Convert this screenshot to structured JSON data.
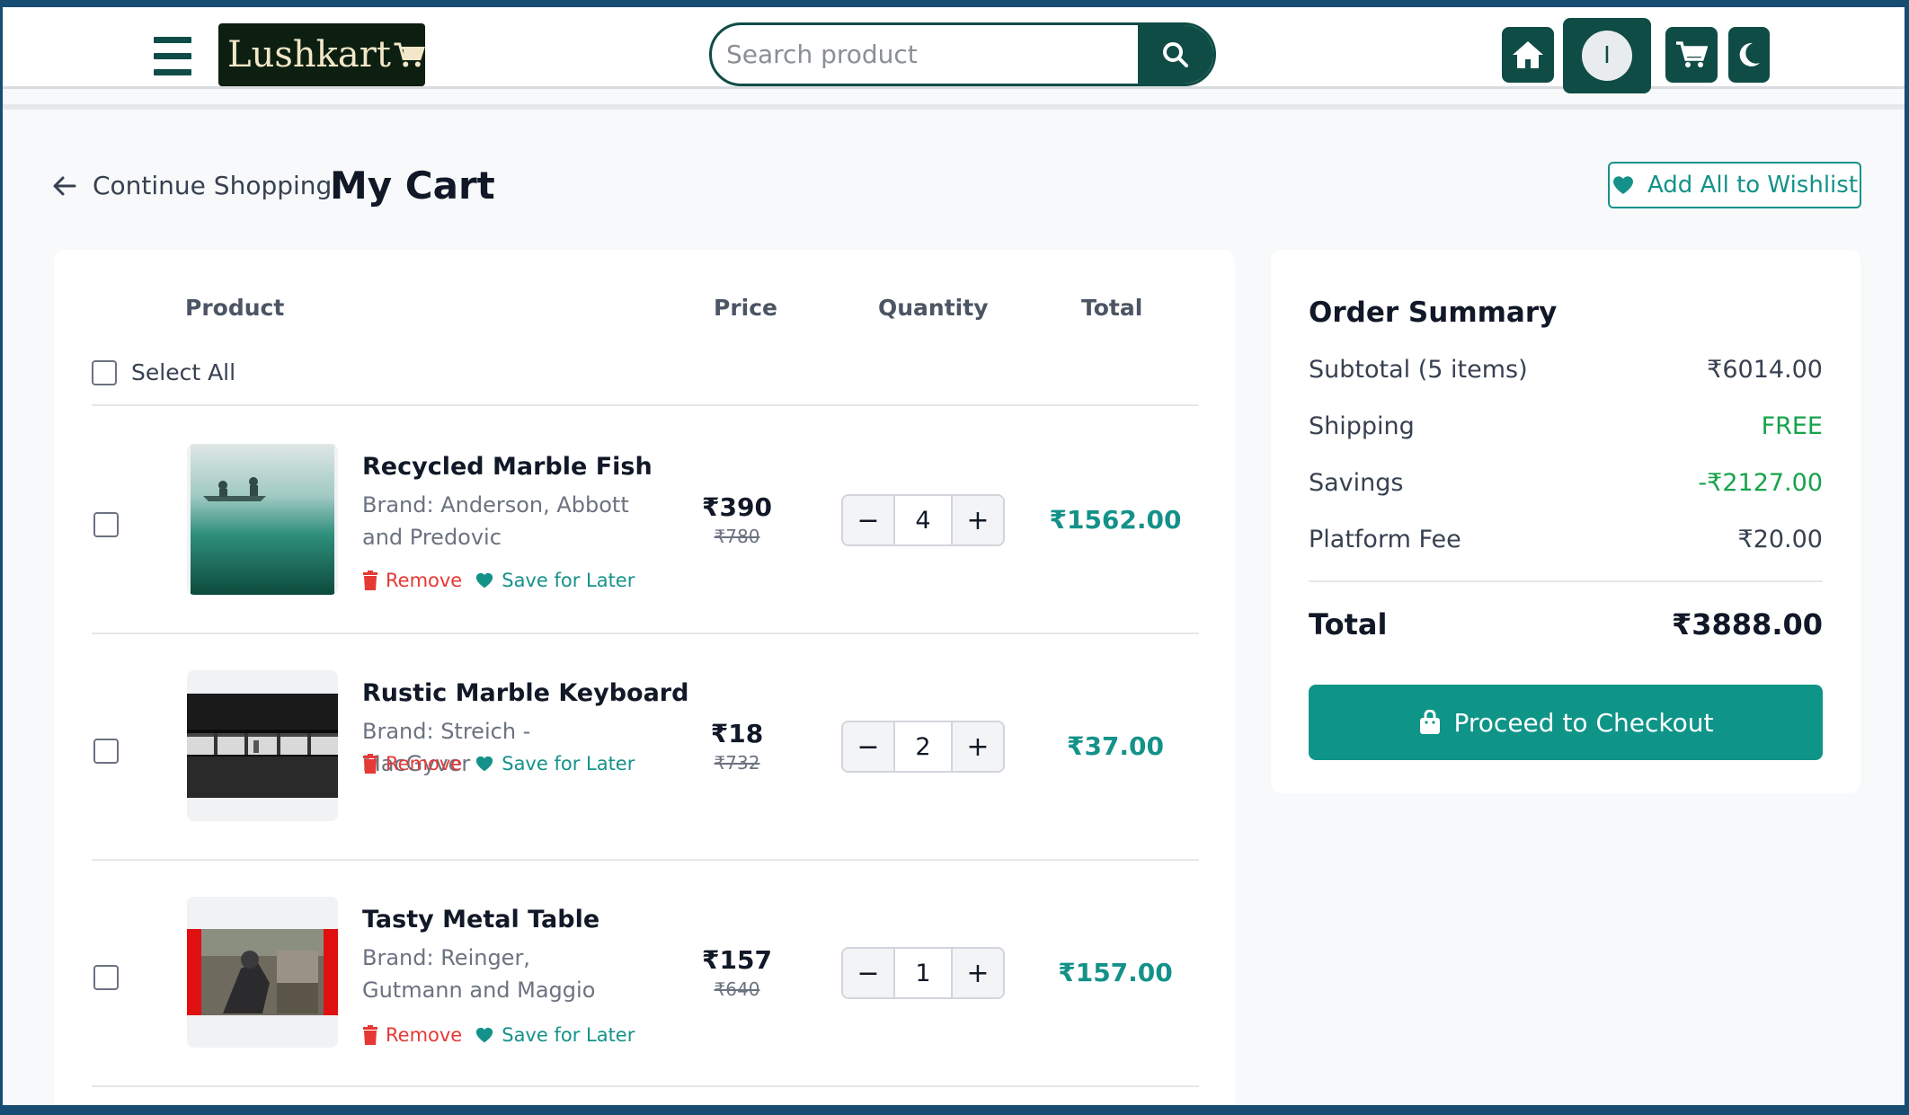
{
  "header": {
    "logo_text": "Lushkart",
    "search_placeholder": "Search product",
    "avatar_initial": "I"
  },
  "page": {
    "back_label": "Continue Shopping",
    "title": "My Cart",
    "wishlist_all_label": "Add All to Wishlist"
  },
  "cart": {
    "columns": {
      "product": "Product",
      "price": "Price",
      "quantity": "Quantity",
      "total": "Total"
    },
    "select_all_label": "Select All",
    "remove_label": "Remove",
    "save_label": "Save for Later",
    "items": [
      {
        "name": "Recycled Marble Fish",
        "brand": "Brand: Anderson, Abbott and Predovic",
        "price": "₹390",
        "old_price": "₹780",
        "qty": "4",
        "total": "₹1562.00",
        "thumb": "lake-canoe-photo"
      },
      {
        "name": "Rustic Marble Keyboard",
        "brand": "Brand: Streich - MacGyver",
        "price": "₹18",
        "old_price": "₹732",
        "qty": "2",
        "total": "₹37.00",
        "thumb": "dark-station-photo"
      },
      {
        "name": "Tasty Metal Table",
        "brand": "Brand: Reinger, Gutmann and Maggio",
        "price": "₹157",
        "old_price": "₹640",
        "qty": "1",
        "total": "₹157.00",
        "thumb": "street-sculpture-photo"
      }
    ]
  },
  "summary": {
    "title": "Order Summary",
    "subtotal_label": "Subtotal (5 items)",
    "subtotal_value": "₹6014.00",
    "shipping_label": "Shipping",
    "shipping_value": "FREE",
    "savings_label": "Savings",
    "savings_value": "-₹2127.00",
    "fee_label": "Platform Fee",
    "fee_value": "₹20.00",
    "total_label": "Total",
    "total_value": "₹3888.00",
    "checkout_label": "Proceed to Checkout"
  },
  "colors": {
    "brand_dark": "#0f4c45",
    "accent": "#14928a",
    "danger": "#e53935",
    "success": "#16a34a"
  }
}
